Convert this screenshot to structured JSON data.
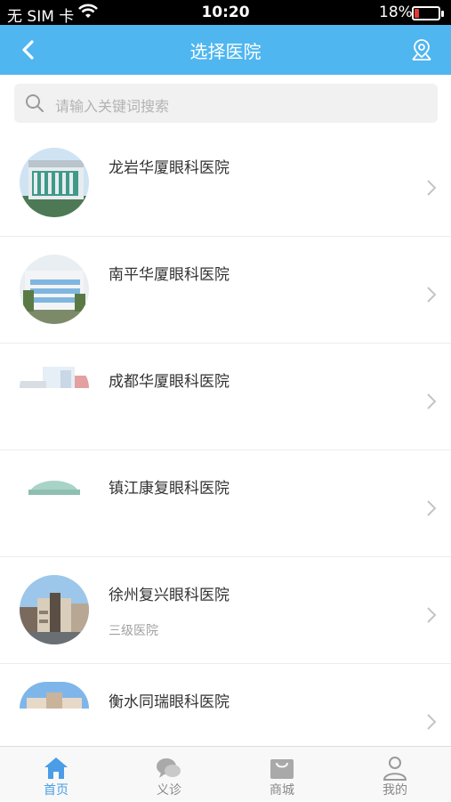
{
  "status_bar": {
    "carrier": "无 SIM 卡",
    "time": "10:20",
    "battery_percent": "18%",
    "battery_level": 0.18,
    "battery_color": "#e53935"
  },
  "nav": {
    "title": "选择医院",
    "back_icon": "chevron-left-icon",
    "right_icon": "location-pin-icon",
    "bg_color": "#4fb6f0"
  },
  "search": {
    "placeholder": "请输入关键词搜索",
    "icon": "search-icon"
  },
  "hospitals": [
    {
      "name": "龙岩华厦眼科医院",
      "level": ""
    },
    {
      "name": "南平华厦眼科医院",
      "level": ""
    },
    {
      "name": "成都华厦眼科医院",
      "level": ""
    },
    {
      "name": "镇江康复眼科医院",
      "level": ""
    },
    {
      "name": "徐州复兴眼科医院",
      "level": "三级医院"
    },
    {
      "name": "衡水同瑞眼科医院",
      "level": ""
    }
  ],
  "tabs": [
    {
      "label": "首页",
      "icon": "home-icon",
      "active": true
    },
    {
      "label": "义诊",
      "icon": "chat-bubble-icon",
      "active": false
    },
    {
      "label": "商城",
      "icon": "shopping-bag-icon",
      "active": false
    },
    {
      "label": "我的",
      "icon": "user-icon",
      "active": false
    }
  ],
  "colors": {
    "accent": "#4fb6f0",
    "tab_active": "#4a9de6",
    "tab_inactive": "#888888"
  }
}
